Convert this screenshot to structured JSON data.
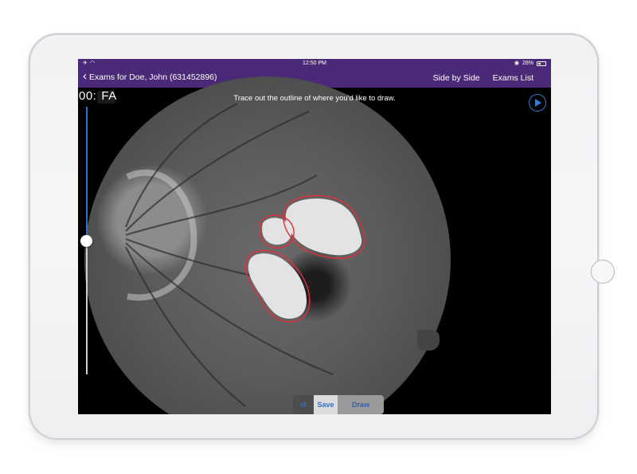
{
  "status_bar": {
    "left_icons": [
      "airplane-icon",
      "wifi-icon"
    ],
    "time": "12:50 PM",
    "battery": "28%"
  },
  "nav": {
    "back_label": "Exams for Doe, John (631452896)",
    "side_by_side": "Side by Side",
    "exams_list": "Exams List"
  },
  "viewer": {
    "instruction": "Trace out the outline of where you'd like to draw.",
    "timer": "00:",
    "exam_type": "FA",
    "slider_value": 0.5
  },
  "toolbar": {
    "undo_icon": "undo-icon",
    "save_label": "Save",
    "draw_label": "Draw"
  },
  "colors": {
    "nav_purple": "#4a2a78",
    "accent_blue": "#2f7fd6",
    "trace_red": "#e0303a"
  }
}
